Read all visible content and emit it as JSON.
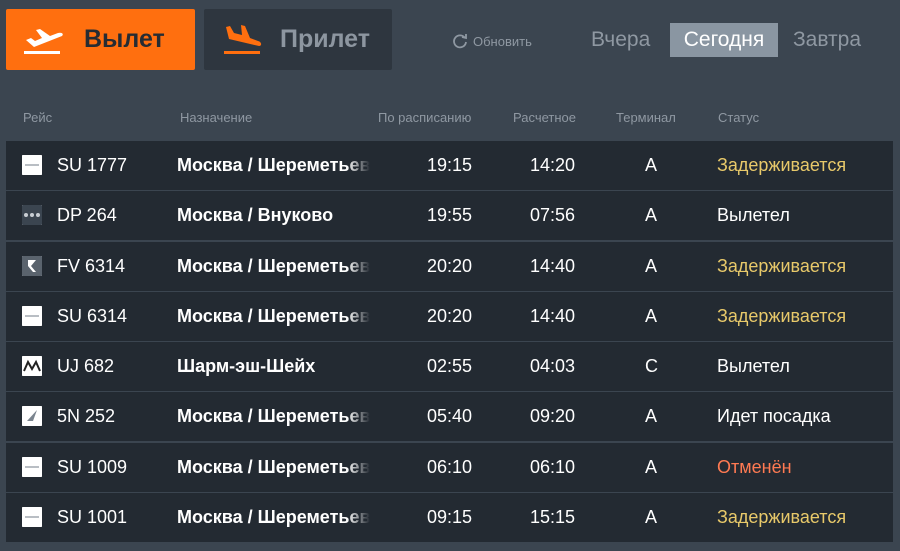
{
  "direction_tabs": {
    "departures_label": "Вылет",
    "arrivals_label": "Прилет"
  },
  "refresh_label": "Обновить",
  "day_tabs": {
    "yesterday": "Вчера",
    "today": "Сегодня",
    "tomorrow": "Завтра",
    "active": "today"
  },
  "columns": {
    "flight": "Рейс",
    "destination": "Назначение",
    "scheduled": "По расписанию",
    "estimated": "Расчетное",
    "terminal": "Терминал",
    "status": "Статус"
  },
  "colors": {
    "accent": "#ff6f0f",
    "delayed": "#e8c96a",
    "cancelled": "#ff7a52",
    "row_bg": "#232a32",
    "page_bg": "#3b4550"
  },
  "flights": [
    {
      "logo": "aeroflot-logo",
      "flight": "SU 1777",
      "destination": "Москва / Шереметьево",
      "scheduled": "19:15",
      "estimated": "14:20",
      "terminal": "A",
      "status": "Задерживается",
      "status_type": "delayed"
    },
    {
      "logo": "pobeda-logo",
      "flight": "DP 264",
      "destination": "Москва / Внуково",
      "scheduled": "19:55",
      "estimated": "07:56",
      "terminal": "A",
      "status": "Вылетел",
      "status_type": "departed"
    },
    {
      "logo": "rossiya-logo",
      "flight": "FV 6314",
      "destination": "Москва / Шереметьево",
      "scheduled": "20:20",
      "estimated": "14:40",
      "terminal": "A",
      "status": "Задерживается",
      "status_type": "delayed"
    },
    {
      "logo": "aeroflot-logo",
      "flight": "SU 6314",
      "destination": "Москва / Шереметьево",
      "scheduled": "20:20",
      "estimated": "14:40",
      "terminal": "A",
      "status": "Задерживается",
      "status_type": "delayed"
    },
    {
      "logo": "alma-logo",
      "flight": "UJ 682",
      "destination": "Шарм-эш-Шейх",
      "scheduled": "02:55",
      "estimated": "04:03",
      "terminal": "C",
      "status": "Вылетел",
      "status_type": "departed"
    },
    {
      "logo": "nordwind-logo",
      "flight": "5N 252",
      "destination": "Москва / Шереметьево",
      "scheduled": "05:40",
      "estimated": "09:20",
      "terminal": "A",
      "status": "Идет посадка",
      "status_type": "boarding"
    },
    {
      "logo": "aeroflot-logo",
      "flight": "SU 1009",
      "destination": "Москва / Шереметьево",
      "scheduled": "06:10",
      "estimated": "06:10",
      "terminal": "A",
      "status": "Отменён",
      "status_type": "cancelled"
    },
    {
      "logo": "aeroflot-logo",
      "flight": "SU 1001",
      "destination": "Москва / Шереметьево",
      "scheduled": "09:15",
      "estimated": "15:15",
      "terminal": "A",
      "status": "Задерживается",
      "status_type": "delayed"
    }
  ]
}
